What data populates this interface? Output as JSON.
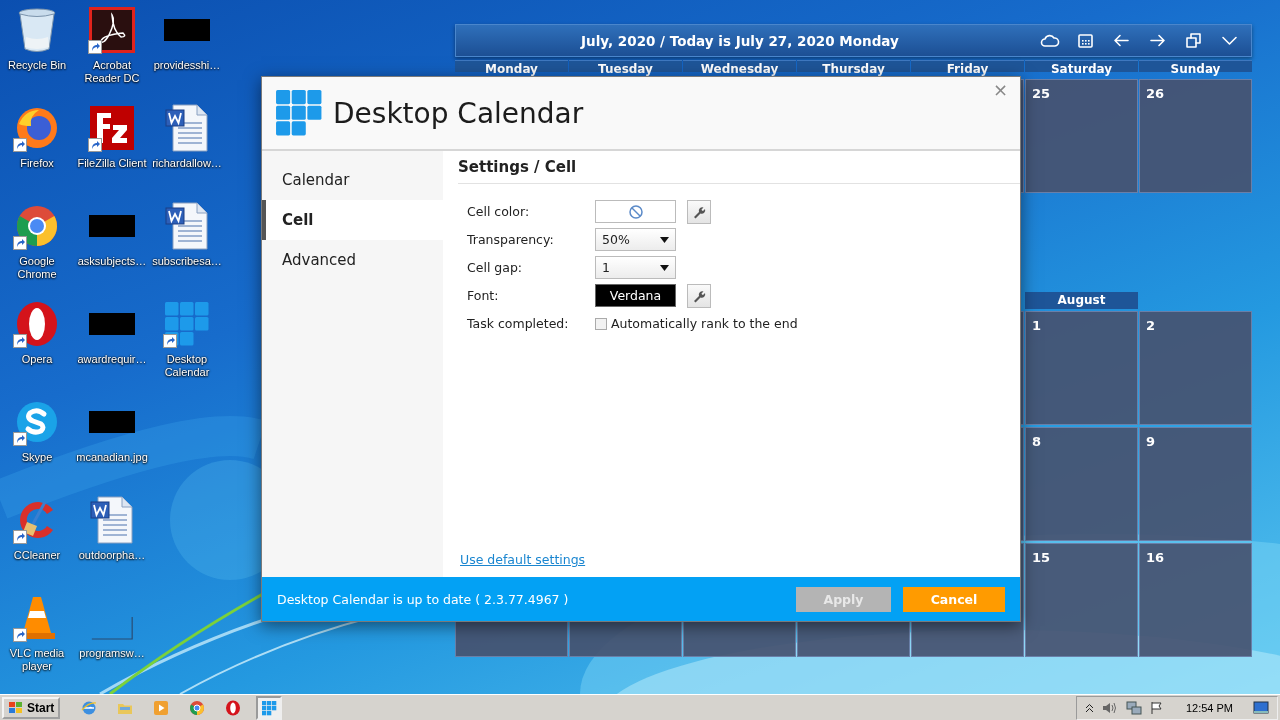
{
  "desktop_icons": [
    {
      "label": "Recycle Bin",
      "shortcut": false
    },
    {
      "label": "Firefox",
      "shortcut": true
    },
    {
      "label": "Google Chrome",
      "shortcut": true
    },
    {
      "label": "Opera",
      "shortcut": true
    },
    {
      "label": "Skype",
      "shortcut": true
    },
    {
      "label": "CCleaner",
      "shortcut": true
    },
    {
      "label": "VLC media player",
      "shortcut": true
    },
    {
      "label": "Acrobat Reader DC",
      "shortcut": true
    },
    {
      "label": "FileZilla Client",
      "shortcut": true
    },
    {
      "label": "asksubjects…",
      "shortcut": false
    },
    {
      "label": "awardrequir…",
      "shortcut": false
    },
    {
      "label": "mcanadian.jpg",
      "shortcut": false
    },
    {
      "label": "outdoorpha…",
      "shortcut": false
    },
    {
      "label": "programsw…",
      "shortcut": false
    },
    {
      "label": "providesshi…",
      "shortcut": false
    },
    {
      "label": "richardallow…",
      "shortcut": false
    },
    {
      "label": "subscribesa…",
      "shortcut": false
    },
    {
      "label": "Desktop Calendar",
      "shortcut": true
    }
  ],
  "calendar": {
    "title": "July, 2020 / Today is July 27, 2020 Monday",
    "weekdays": [
      "Monday",
      "Tuesday",
      "Wednesday",
      "Thursday",
      "Friday",
      "Saturday",
      "Sunday"
    ],
    "weeks": [
      {
        "kind": "week",
        "days": [
          "25",
          "26"
        ]
      },
      {
        "kind": "month",
        "label": "August"
      },
      {
        "kind": "week",
        "days": [
          "1",
          "2"
        ]
      },
      {
        "kind": "week",
        "days": [
          "8",
          "9"
        ]
      },
      {
        "kind": "week",
        "days": [
          "15",
          "16"
        ]
      }
    ]
  },
  "dialog": {
    "title": "Desktop Calendar",
    "close": "×",
    "nav": [
      {
        "label": "Calendar",
        "selected": false
      },
      {
        "label": "Cell",
        "selected": true
      },
      {
        "label": "Advanced",
        "selected": false
      }
    ],
    "heading": "Settings / Cell",
    "fields": [
      {
        "kind": "color",
        "label": "Cell color:"
      },
      {
        "kind": "select",
        "label": "Transparency:",
        "value": "50%"
      },
      {
        "kind": "select",
        "label": "Cell gap:",
        "value": "1"
      },
      {
        "kind": "font",
        "label": "Font:",
        "value": "Verdana"
      },
      {
        "kind": "checkbox",
        "label": "Task completed:",
        "option": "Automatically rank to the end",
        "checked": false
      }
    ],
    "default_link": "Use default settings",
    "status": "Desktop Calendar is up to date ( 2.3.77.4967 )",
    "buttons": [
      {
        "label": "Apply",
        "kind": "apply",
        "disabled": true
      },
      {
        "label": "Cancel",
        "kind": "cancel",
        "disabled": false
      }
    ]
  },
  "taskbar": {
    "start": "Start",
    "apps": [
      {
        "active": false
      },
      {
        "active": false
      },
      {
        "active": false
      },
      {
        "active": false
      },
      {
        "active": false
      },
      {
        "active": true
      }
    ],
    "clock": "12:54 PM"
  }
}
